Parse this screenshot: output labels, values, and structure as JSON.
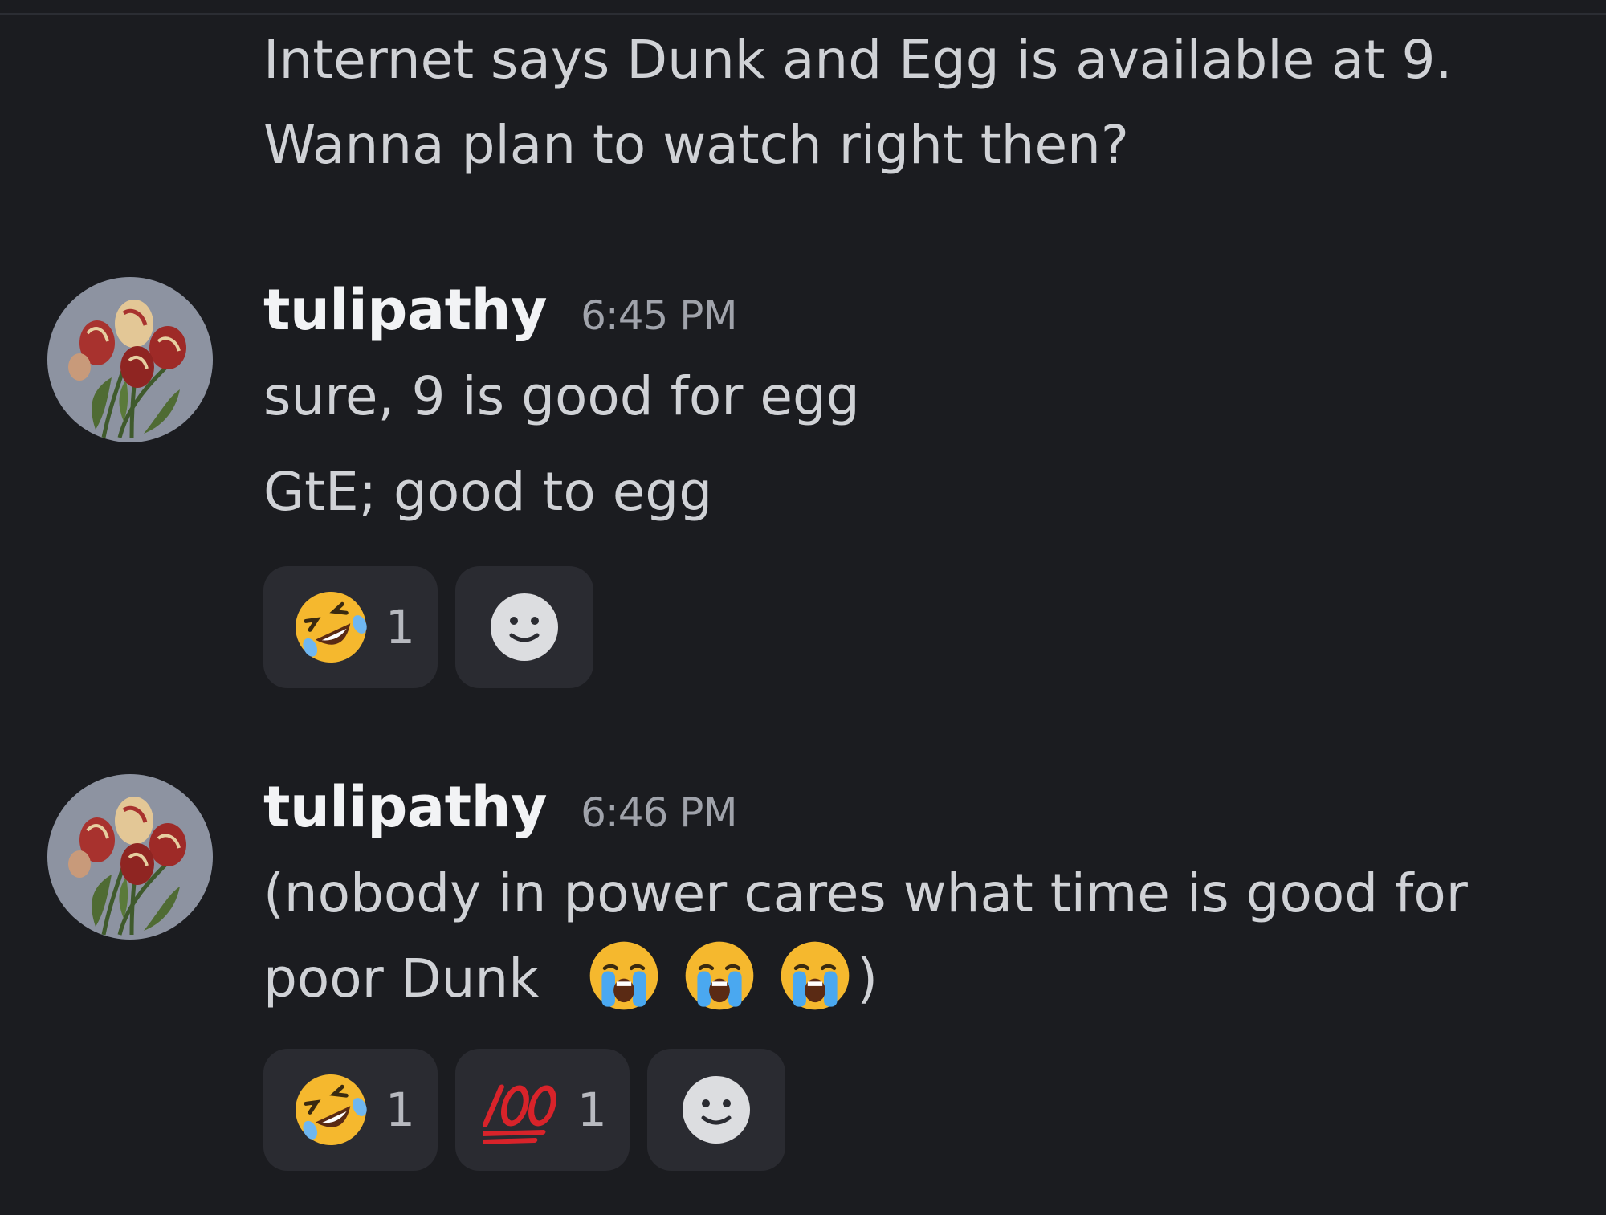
{
  "previous_message": {
    "lines": [
      "Internet says Dunk and Egg is available at 9.",
      "Wanna plan to watch right then?"
    ]
  },
  "messages": [
    {
      "username": "tulipathy",
      "timestamp": "6:45 PM",
      "avatar_icon": "tulip-bouquet-icon",
      "lines": [
        "sure, 9 is good for egg",
        "GtE; good to egg"
      ],
      "reactions": [
        {
          "emoji": "rolling-on-floor-laughing",
          "count": "1"
        }
      ]
    },
    {
      "username": "tulipathy",
      "timestamp": "6:46 PM",
      "avatar_icon": "tulip-bouquet-icon",
      "lines": [
        "(nobody in power cares what time is good for",
        "poor Dunk",
        ")"
      ],
      "inline_emoji": [
        "loudly-crying-face",
        "loudly-crying-face",
        "loudly-crying-face"
      ],
      "reactions": [
        {
          "emoji": "rolling-on-floor-laughing",
          "count": "1"
        },
        {
          "emoji": "hundred-points",
          "count": "1"
        }
      ]
    }
  ],
  "colors": {
    "background": "#1b1c20",
    "text": "#d0d2d6",
    "username": "#f2f3f5",
    "timestamp": "#a0a3ab",
    "reaction_bg": "#2a2b31"
  }
}
